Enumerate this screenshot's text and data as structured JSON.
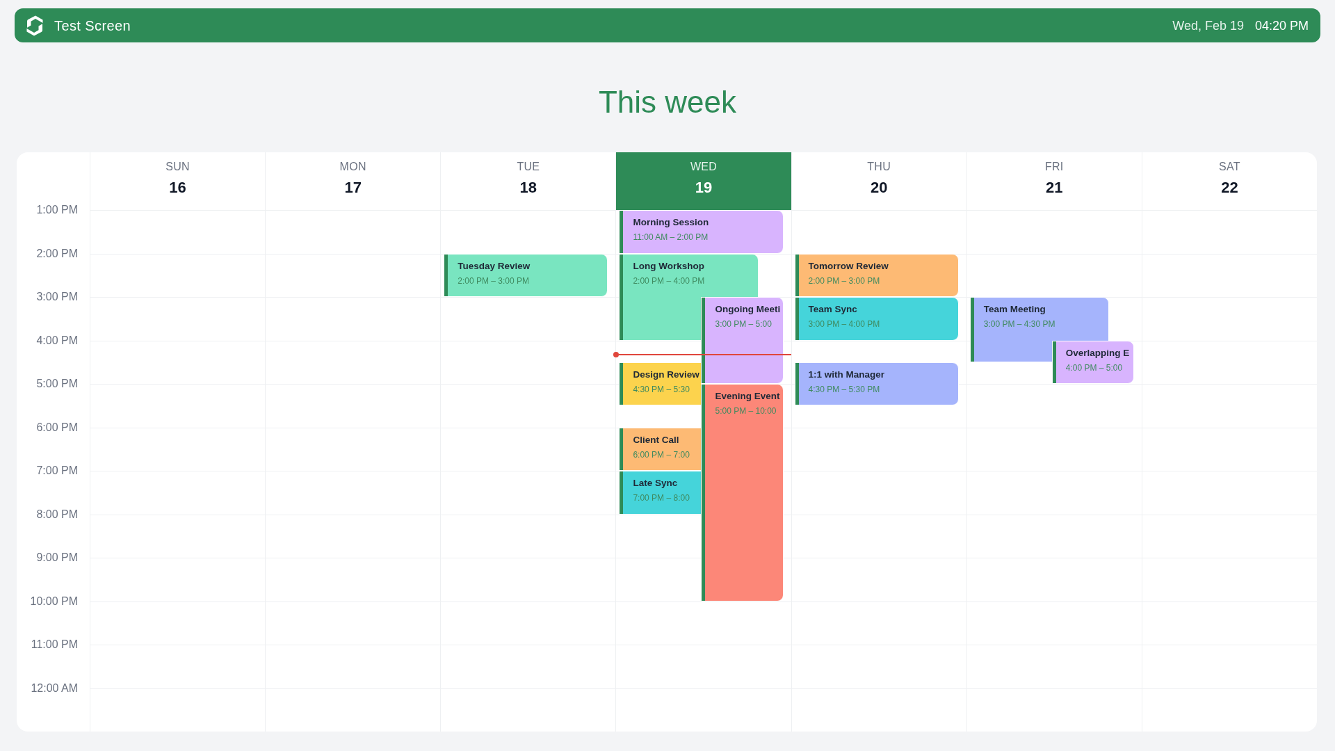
{
  "app_bar": {
    "title": "Test Screen",
    "date": "Wed, Feb 19",
    "time": "04:20 PM"
  },
  "heading": "This week",
  "calendar": {
    "hours": [
      "1:00 PM",
      "2:00 PM",
      "3:00 PM",
      "4:00 PM",
      "5:00 PM",
      "6:00 PM",
      "7:00 PM",
      "8:00 PM",
      "9:00 PM",
      "10:00 PM",
      "11:00 PM",
      "12:00 AM"
    ],
    "days": [
      {
        "weekday": "SUN",
        "date": "16",
        "today": false
      },
      {
        "weekday": "MON",
        "date": "17",
        "today": false
      },
      {
        "weekday": "TUE",
        "date": "18",
        "today": false,
        "events": [
          {
            "title": "Tuesday Review",
            "time": "2:00 PM – 3:00 PM",
            "color": "#79e5c0"
          }
        ]
      },
      {
        "weekday": "WED",
        "date": "19",
        "today": true,
        "events": [
          {
            "title": "Morning Session",
            "time": "11:00 AM – 2:00 PM",
            "color": "#d8b4fe"
          },
          {
            "title": "Long Workshop",
            "time": "2:00 PM – 4:00 PM",
            "color": "#79e5c0"
          },
          {
            "title": "Ongoing Meeti",
            "time": "3:00 PM – 5:00",
            "color": "#d8b4fe"
          },
          {
            "title": "Design Review",
            "time": "4:30 PM – 5:30",
            "color": "#fcd34d"
          },
          {
            "title": "Evening Event",
            "time": "5:00 PM – 10:00",
            "color": "#fc8778"
          },
          {
            "title": "Client Call",
            "time": "6:00 PM – 7:00",
            "color": "#fdba74"
          },
          {
            "title": "Late Sync",
            "time": "7:00 PM – 8:00",
            "color": "#45d4da"
          }
        ]
      },
      {
        "weekday": "THU",
        "date": "20",
        "today": false,
        "events": [
          {
            "title": "Tomorrow Review",
            "time": "2:00 PM – 3:00 PM",
            "color": "#fdba74"
          },
          {
            "title": "Team Sync",
            "time": "3:00 PM – 4:00 PM",
            "color": "#45d4da"
          },
          {
            "title": "1:1 with Manager",
            "time": "4:30 PM – 5:30 PM",
            "color": "#a5b4fc"
          }
        ]
      },
      {
        "weekday": "FRI",
        "date": "21",
        "today": false,
        "events": [
          {
            "title": "Team Meeting",
            "time": "3:00 PM – 4:30 PM",
            "color": "#a5b4fc"
          },
          {
            "title": "Overlapping E",
            "time": "4:00 PM – 5:00",
            "color": "#d8b4fe"
          }
        ]
      },
      {
        "weekday": "SAT",
        "date": "22",
        "today": false
      }
    ]
  }
}
